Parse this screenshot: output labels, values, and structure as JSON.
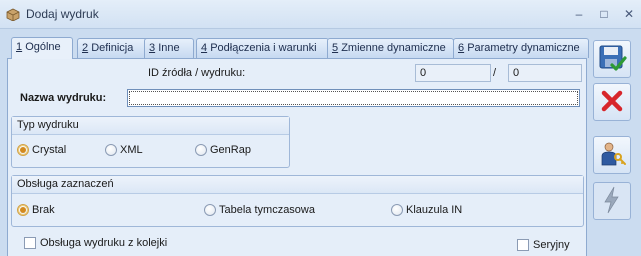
{
  "window": {
    "title": "Dodaj wydruk",
    "min": "–",
    "max": "□",
    "close": "✕"
  },
  "tabs": [
    {
      "num": "1",
      "label": "Ogólne"
    },
    {
      "num": "2",
      "label": "Definicja"
    },
    {
      "num": "3",
      "label": "Inne"
    },
    {
      "num": "4",
      "label": "Podłączenia i warunki"
    },
    {
      "num": "5",
      "label": "Zmienne dynamiczne"
    },
    {
      "num": "6",
      "label": "Parametry dynamiczne"
    }
  ],
  "form": {
    "id_label": "ID źródła / wydruku:",
    "id_source": "0",
    "id_separator": "/",
    "id_print": "0",
    "name_label": "Nazwa wydruku:",
    "name_value": ""
  },
  "print_type": {
    "title": "Typ wydruku",
    "options": [
      "Crystal",
      "XML",
      "GenRap"
    ],
    "selected": "Crystal"
  },
  "selection_handling": {
    "title": "Obsługa zaznaczeń",
    "options": [
      "Brak",
      "Tabela tymczasowa",
      "Klauzula IN"
    ],
    "selected": "Brak"
  },
  "checkboxes": {
    "queue_label": "Obsługa wydruku z kolejki",
    "queue_checked": false,
    "serial_label": "Seryjny",
    "serial_checked": false
  },
  "side_buttons": {
    "save": "save-icon",
    "cancel": "cancel-icon",
    "users": "user-key-icon",
    "lightning": "lightning-icon"
  },
  "colors": {
    "accent": "#2f6fb7",
    "selected_radio": "#d38a1e",
    "cancel_red": "#d7262b",
    "save_green": "#2e9a35"
  }
}
